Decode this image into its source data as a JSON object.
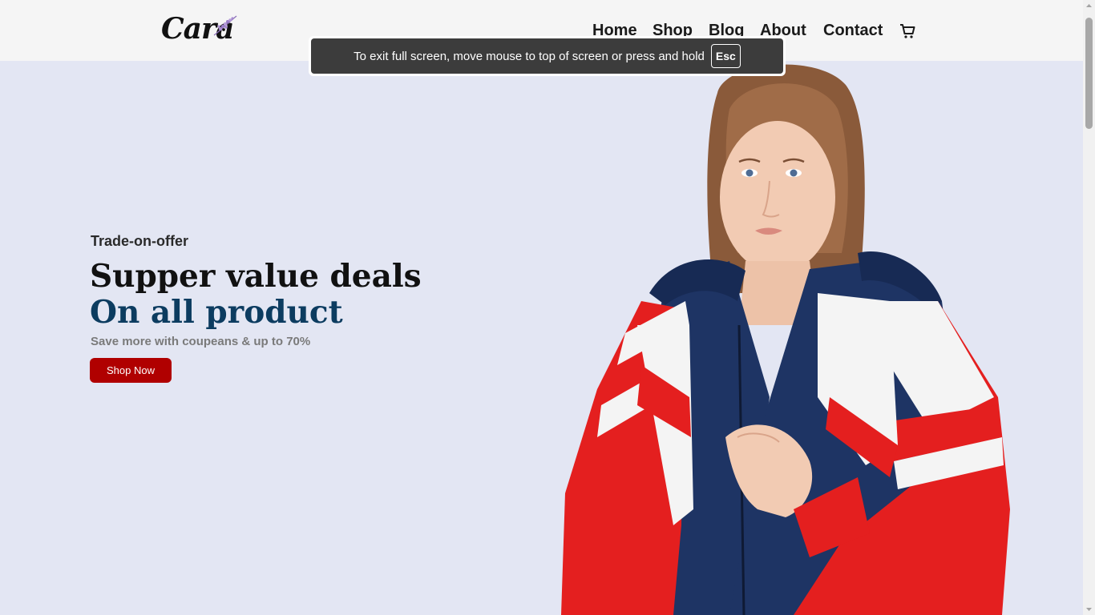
{
  "header": {
    "logo_text": "Cara",
    "nav": [
      {
        "label": "Home"
      },
      {
        "label": "Shop"
      },
      {
        "label": "Blog"
      },
      {
        "label": "About"
      },
      {
        "label": "Contact"
      }
    ],
    "cart_icon": "cart-icon"
  },
  "fullscreen_toast": {
    "message": "To exit full screen, move mouse to top of screen or press and hold",
    "key": "Esc"
  },
  "hero": {
    "tagline": "Trade-on-offer",
    "heading": "Supper value deals",
    "subheading": "On all product",
    "description": "Save more with coupeans & up to 70%",
    "button_label": "Shop Now"
  },
  "colors": {
    "header_bg": "#f5f5f5",
    "hero_bg": "#e3e6f3",
    "accent_blue": "#0c3c60",
    "button_red": "#b00000"
  }
}
